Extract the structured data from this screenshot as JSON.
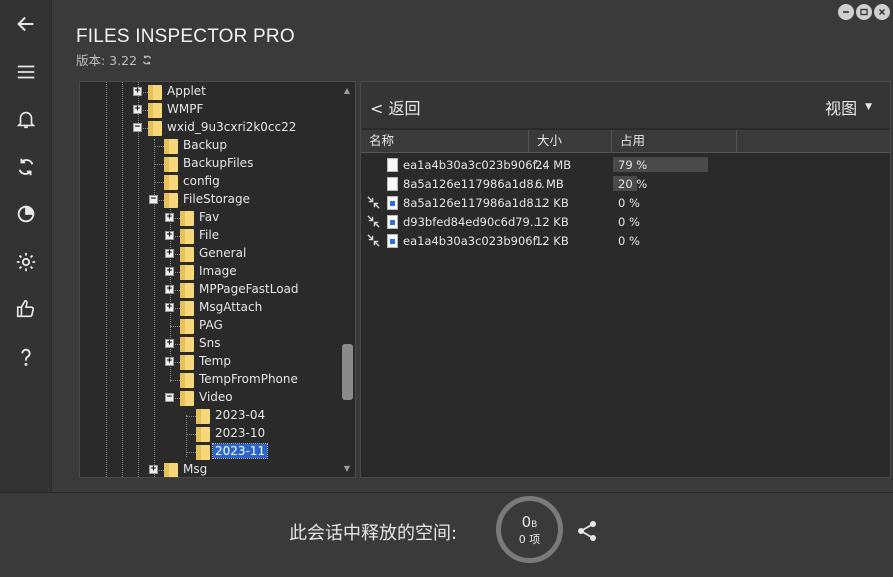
{
  "app": {
    "title": "FILES INSPECTOR PRO",
    "version": "版本: 3.22"
  },
  "rail": [
    "back-arrow-icon",
    "menu-icon",
    "bell-icon",
    "refresh-icon",
    "disk-icon",
    "gear-icon",
    "thumbs-up-icon",
    "help-icon"
  ],
  "tree": {
    "nodes": [
      {
        "label": "Applet",
        "level": 3,
        "expander": "+"
      },
      {
        "label": "WMPF",
        "level": 3,
        "expander": "+"
      },
      {
        "label": "wxid_9u3cxri2k0cc22",
        "level": 3,
        "expander": "-"
      },
      {
        "label": "Backup",
        "level": 4,
        "expander": ""
      },
      {
        "label": "BackupFiles",
        "level": 4,
        "expander": ""
      },
      {
        "label": "config",
        "level": 4,
        "expander": ""
      },
      {
        "label": "FileStorage",
        "level": 4,
        "expander": "-"
      },
      {
        "label": "Fav",
        "level": 5,
        "expander": "+"
      },
      {
        "label": "File",
        "level": 5,
        "expander": "+"
      },
      {
        "label": "General",
        "level": 5,
        "expander": "+"
      },
      {
        "label": "Image",
        "level": 5,
        "expander": "+"
      },
      {
        "label": "MPPageFastLoad",
        "level": 5,
        "expander": "+"
      },
      {
        "label": "MsgAttach",
        "level": 5,
        "expander": "+"
      },
      {
        "label": "PAG",
        "level": 5,
        "expander": ""
      },
      {
        "label": "Sns",
        "level": 5,
        "expander": "+"
      },
      {
        "label": "Temp",
        "level": 5,
        "expander": "+"
      },
      {
        "label": "TempFromPhone",
        "level": 5,
        "expander": ""
      },
      {
        "label": "Video",
        "level": 5,
        "expander": "-"
      },
      {
        "label": "2023-04",
        "level": 6,
        "expander": ""
      },
      {
        "label": "2023-10",
        "level": 6,
        "expander": ""
      },
      {
        "label": "2023-11",
        "level": 6,
        "expander": "",
        "selected": true
      },
      {
        "label": "Msg",
        "level": 4,
        "expander": "+"
      }
    ]
  },
  "nav": {
    "back_label": "< 返回",
    "view_label": "视图",
    "view_caret": "▼"
  },
  "grid": {
    "headers": [
      "名称",
      "大小",
      "占用"
    ],
    "rows": [
      {
        "icon": "doc-icon",
        "shrink": false,
        "name": "ea1a4b30a3c023b906f...",
        "size": "24 MB",
        "percent_text": "79 %",
        "percent": 79
      },
      {
        "icon": "doc-icon",
        "shrink": false,
        "name": "8a5a126e117986a1d8...",
        "size": "6 MB",
        "percent_text": "20 %",
        "percent": 20
      },
      {
        "icon": "doc-blue-icon",
        "shrink": true,
        "name": "8a5a126e117986a1d8...",
        "size": "12 KB",
        "percent_text": "0 %",
        "percent": 0
      },
      {
        "icon": "doc-blue-icon",
        "shrink": true,
        "name": "d93bfed84ed90c6d79...",
        "size": "12 KB",
        "percent_text": "0 %",
        "percent": 0
      },
      {
        "icon": "doc-blue-icon",
        "shrink": true,
        "name": "ea1a4b30a3c023b906f...",
        "size": "12 KB",
        "percent_text": "0 %",
        "percent": 0
      }
    ]
  },
  "footer": {
    "freed_label": "此会话中释放的空间:",
    "freed_size": "0",
    "freed_unit": "B",
    "freed_items": "0 项"
  }
}
